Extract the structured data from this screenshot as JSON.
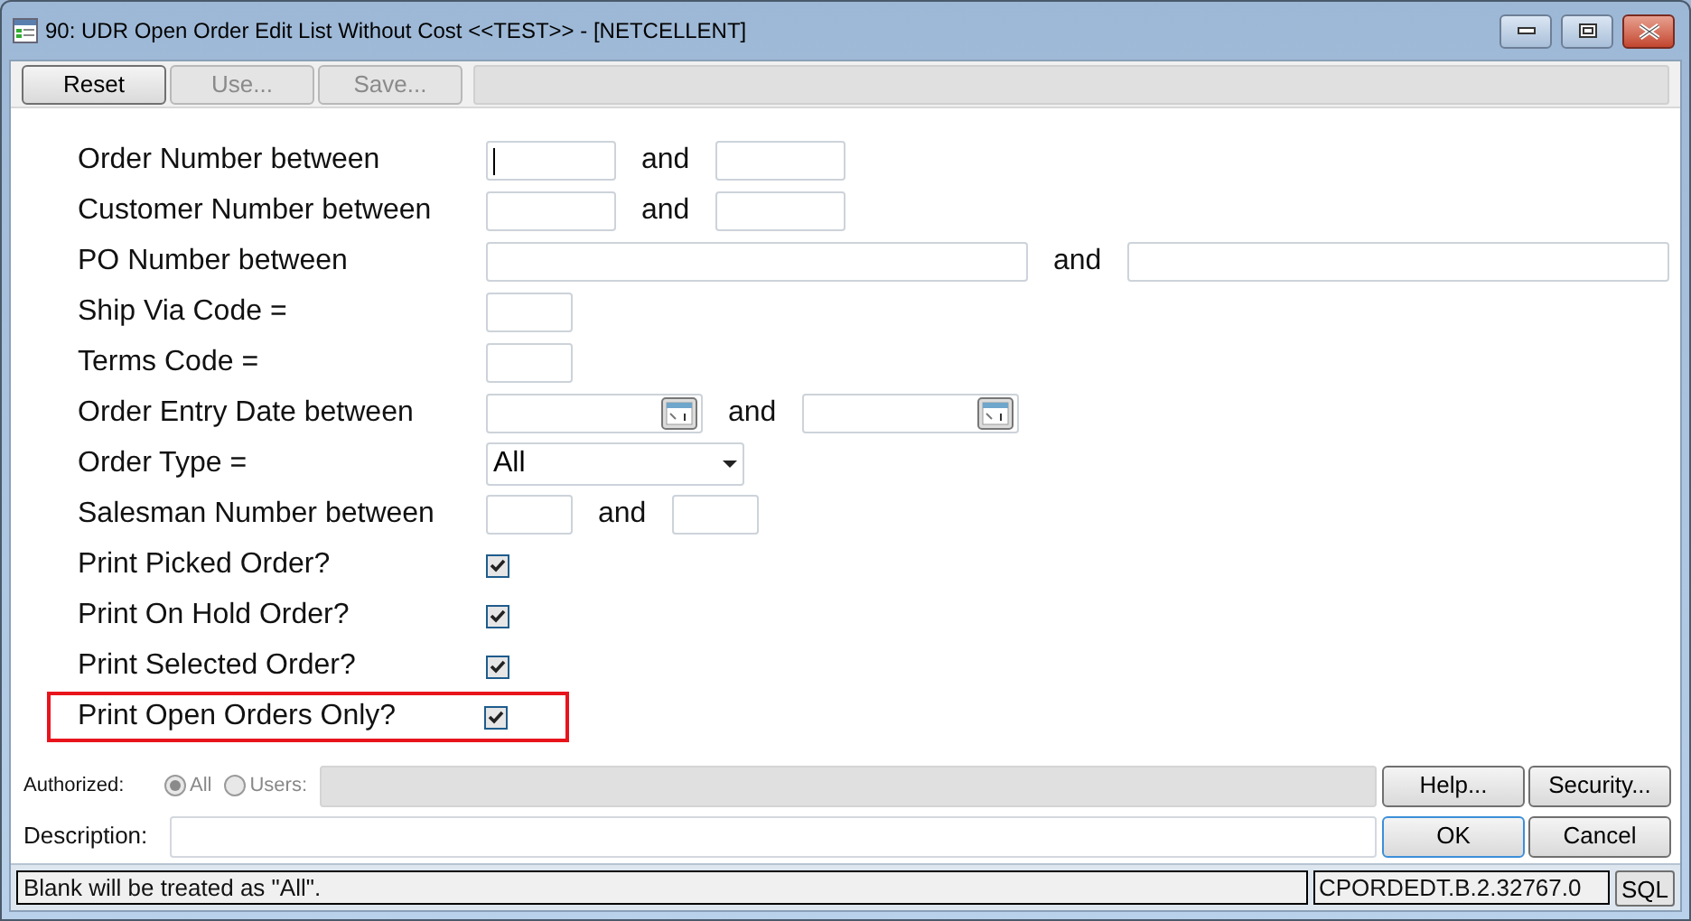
{
  "window": {
    "title": "90:  UDR Open Order Edit List Without Cost <<TEST>> - [NETCELLENT]"
  },
  "toolbar": [
    {
      "label": "Reset",
      "disabled": false
    },
    {
      "label": "Use...",
      "disabled": true
    },
    {
      "label": "Save...",
      "disabled": true
    }
  ],
  "criteria": [
    {
      "kind": "range",
      "label": "Order Number between",
      "joiner": "and",
      "focused": true
    },
    {
      "kind": "range",
      "label": "Customer Number between",
      "joiner": "and",
      "focused": false
    },
    {
      "kind": "wide_range",
      "label": "PO Number between",
      "joiner": "and",
      "focused": false
    },
    {
      "kind": "field",
      "label": "Ship Via Code ="
    },
    {
      "kind": "field",
      "label": "Terms Code ="
    },
    {
      "kind": "date_range",
      "label": "Order Entry Date between",
      "joiner": "and"
    },
    {
      "kind": "select",
      "label": "Order Type =",
      "value": "All"
    },
    {
      "kind": "short_range",
      "label": "Salesman Number between",
      "joiner": "and",
      "focused": false
    },
    {
      "kind": "checkbox",
      "label": "Print Picked Order?",
      "checked": true,
      "highlighted": false
    },
    {
      "kind": "checkbox",
      "label": "Print On Hold Order?",
      "checked": true,
      "highlighted": false
    },
    {
      "kind": "checkbox",
      "label": "Print Selected Order?",
      "checked": true,
      "highlighted": false
    },
    {
      "kind": "checkbox",
      "label": "Print Open Orders Only?",
      "checked": true,
      "highlighted": true
    }
  ],
  "authorized": {
    "label": "Authorized:",
    "options": [
      {
        "label": "All",
        "selected": true
      },
      {
        "label": "Users:",
        "selected": false
      }
    ]
  },
  "description": {
    "label": "Description:"
  },
  "buttons": [
    {
      "label": "Help...",
      "default": false
    },
    {
      "label": "Security...",
      "default": false
    },
    {
      "label": "OK",
      "default": true
    },
    {
      "label": "Cancel",
      "default": false
    }
  ],
  "status_bar": {
    "message": "Blank will be treated as \"All\".",
    "code": "CPORDEDT.B.2.32767.0",
    "sql": "SQL"
  }
}
